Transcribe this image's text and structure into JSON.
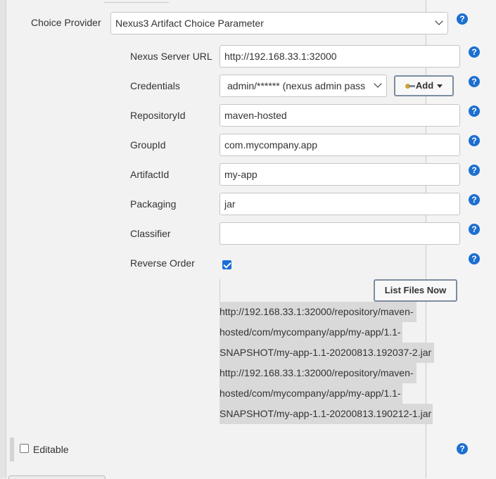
{
  "choice_provider": {
    "label": "Choice Provider",
    "selected": "Nexus3 Artifact Choice Parameter"
  },
  "nexus_server_url": {
    "label": "Nexus Server URL",
    "value": "http://192.168.33.1:32000"
  },
  "credentials": {
    "label": "Credentials",
    "selected": "admin/****** (nexus admin pass",
    "add_label": "Add"
  },
  "repository_id": {
    "label": "RepositoryId",
    "value": "maven-hosted"
  },
  "group_id": {
    "label": "GroupId",
    "value": "com.mycompany.app"
  },
  "artifact_id": {
    "label": "ArtifactId",
    "value": "my-app"
  },
  "packaging": {
    "label": "Packaging",
    "value": "jar"
  },
  "classifier": {
    "label": "Classifier",
    "value": ""
  },
  "reverse_order": {
    "label": "Reverse Order",
    "checked": true
  },
  "list_files_button": "List Files Now",
  "results": [
    "http://192.168.33.1:32000/repository/maven-",
    "hosted/com/mycompany/app/my-app/1.1-",
    "SNAPSHOT/my-app-1.1-20200813.192037-2.jar",
    "http://192.168.33.1:32000/repository/maven-",
    "hosted/com/mycompany/app/my-app/1.1-",
    "SNAPSHOT/my-app-1.1-20200813.190212-1.jar"
  ],
  "editable": {
    "label": "Editable",
    "checked": false
  },
  "help_glyph": "?",
  "colors": {
    "help_icon": "#1c6fd1",
    "checkbox_checked": "#1a6fd6",
    "result_highlight": "#d9d9d9"
  }
}
